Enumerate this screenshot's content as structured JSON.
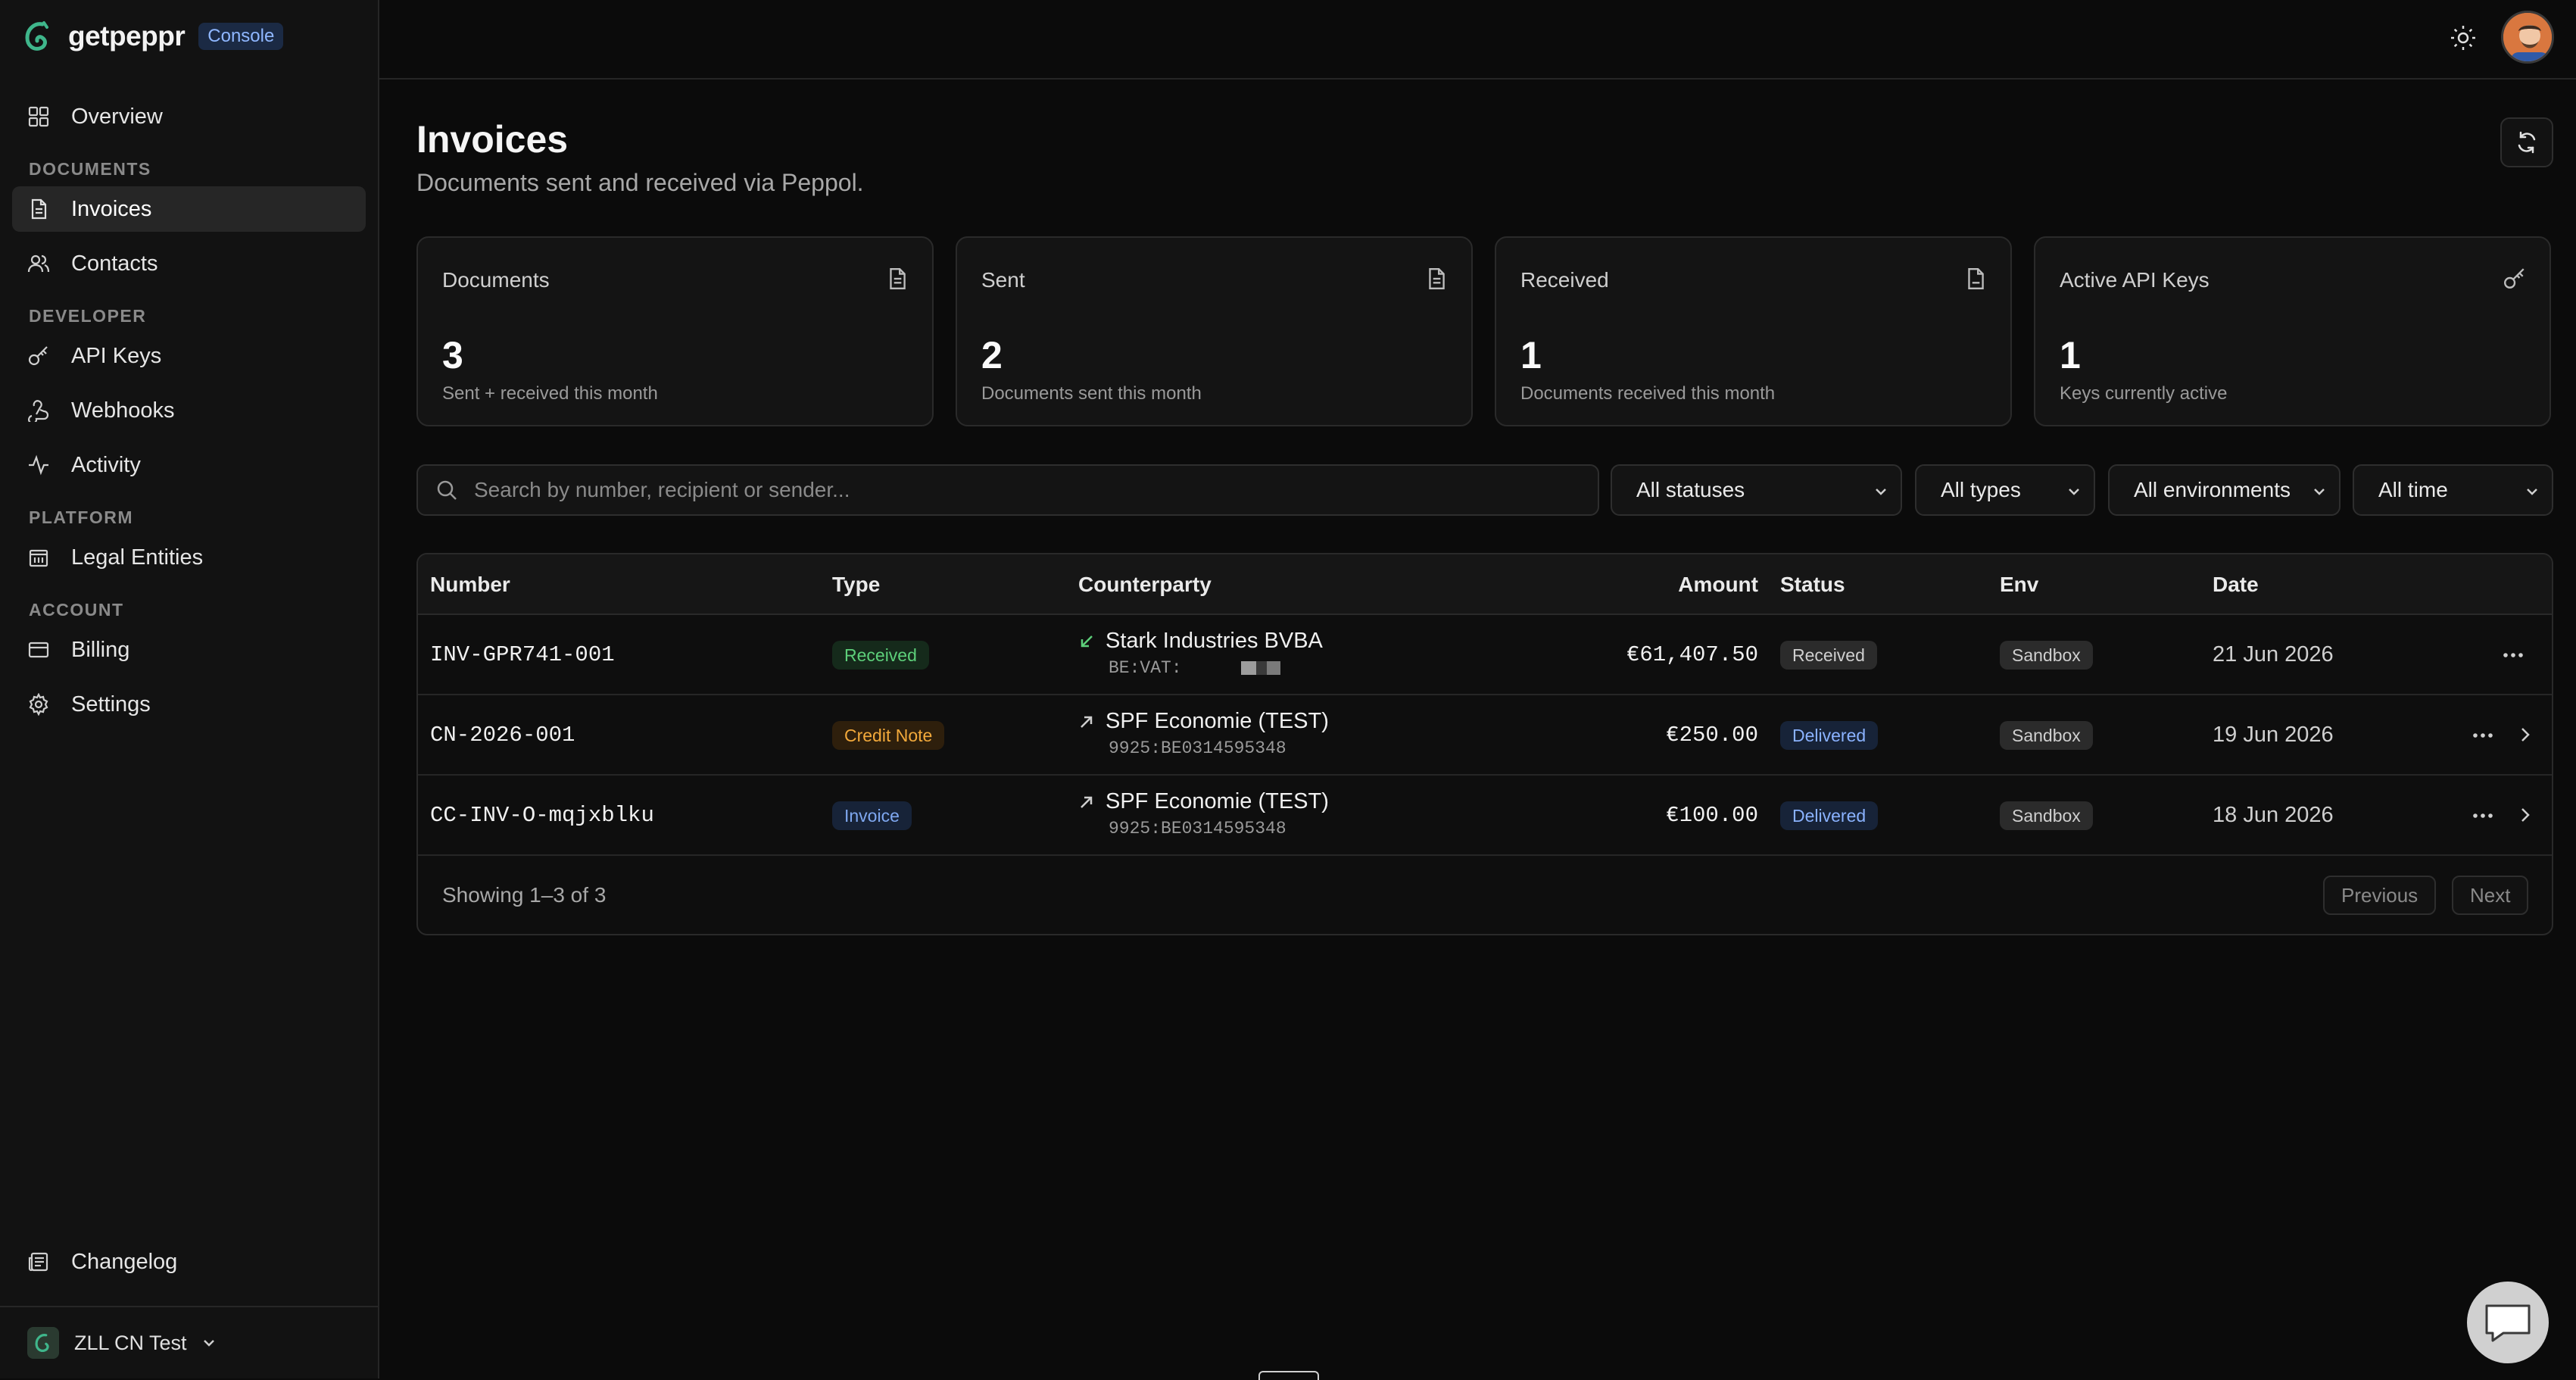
{
  "brand": {
    "name": "getpeppr",
    "badge": "Console"
  },
  "sidebar": {
    "overview": "Overview",
    "sections": {
      "documents": "DOCUMENTS",
      "developer": "DEVELOPER",
      "platform": "PLATFORM",
      "account": "ACCOUNT"
    },
    "items": {
      "invoices": "Invoices",
      "contacts": "Contacts",
      "api_keys": "API Keys",
      "webhooks": "Webhooks",
      "activity": "Activity",
      "legal_entities": "Legal Entities",
      "billing": "Billing",
      "settings": "Settings"
    },
    "changelog": "Changelog",
    "org": "ZLL CN Test"
  },
  "page": {
    "title": "Invoices",
    "subtitle": "Documents sent and received via Peppol."
  },
  "stats": [
    {
      "title": "Documents",
      "value": "3",
      "note": "Sent + received this month",
      "icon": "document-icon"
    },
    {
      "title": "Sent",
      "value": "2",
      "note": "Documents sent this month",
      "icon": "document-icon"
    },
    {
      "title": "Received",
      "value": "1",
      "note": "Documents received this month",
      "icon": "document-icon"
    },
    {
      "title": "Active API Keys",
      "value": "1",
      "note": "Keys currently active",
      "icon": "key-icon"
    }
  ],
  "filters": {
    "search_placeholder": "Search by number, recipient or sender...",
    "status": "All statuses",
    "type": "All types",
    "environment": "All environments",
    "time": "All time"
  },
  "table": {
    "headers": {
      "number": "Number",
      "type": "Type",
      "counterparty": "Counterparty",
      "amount": "Amount",
      "status": "Status",
      "env": "Env",
      "date": "Date"
    },
    "rows": [
      {
        "number": "INV-GPR741-001",
        "type": "Received",
        "counterparty": "Stark Industries BVBA",
        "counterparty_id": "BE:VAT:",
        "amount": "€61,407.50",
        "status": "Received",
        "env": "Sandbox",
        "date": "21 Jun 2026"
      },
      {
        "number": "CN-2026-001",
        "type": "Credit Note",
        "counterparty": "SPF Economie (TEST)",
        "counterparty_id": "9925:BE0314595348",
        "amount": "€250.00",
        "status": "Delivered",
        "env": "Sandbox",
        "date": "19 Jun 2026"
      },
      {
        "number": "CC-INV-O-mqjxblku",
        "type": "Invoice",
        "counterparty": "SPF Economie (TEST)",
        "counterparty_id": "9925:BE0314595348",
        "amount": "€100.00",
        "status": "Delivered",
        "env": "Sandbox",
        "date": "18 Jun 2026"
      }
    ],
    "footer": {
      "showing": "Showing 1–3 of 3",
      "previous": "Previous",
      "next": "Next"
    }
  },
  "colors": {
    "background": "#0b0b0b",
    "sidebar": "#121212",
    "accent_green": "#5dcf7a",
    "accent_orange": "#f2a93b",
    "accent_blue": "#7fa8f0"
  }
}
